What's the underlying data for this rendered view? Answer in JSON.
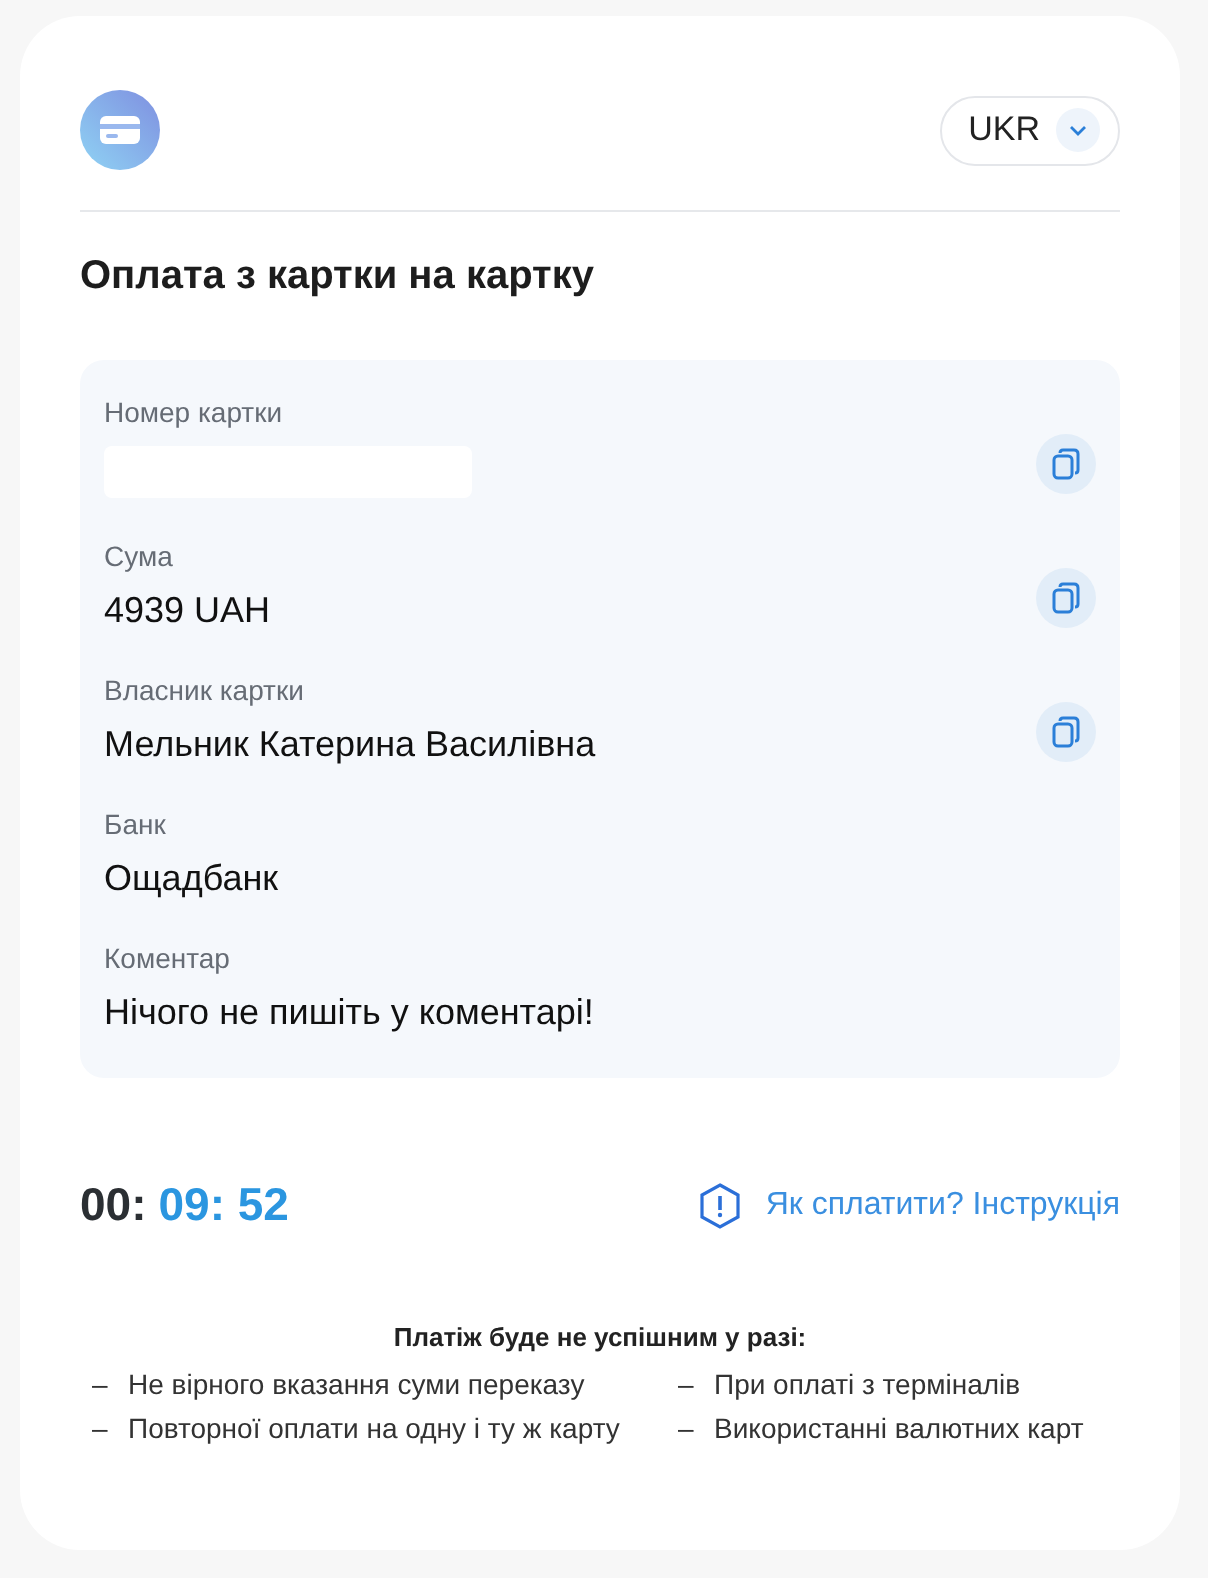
{
  "header": {
    "language": "UKR"
  },
  "title": "Оплата з картки на картку",
  "details": [
    {
      "label": "Номер картки",
      "kind": "redacted",
      "copyable": true
    },
    {
      "label": "Сума",
      "kind": "text",
      "value": "4939 UAH",
      "copyable": true
    },
    {
      "label": "Власник картки",
      "kind": "text",
      "value": "Мельник Катерина Василівна",
      "copyable": true
    },
    {
      "label": "Банк",
      "kind": "text",
      "value": "Ощадбанк",
      "copyable": false
    },
    {
      "label": "Коментар",
      "kind": "text",
      "value": "Нічого не пишіть у коментарі!",
      "copyable": false
    }
  ],
  "timer": [
    {
      "text": "00:",
      "highlighted": false
    },
    {
      "text": "09: 52",
      "highlighted": true
    }
  ],
  "help_link": "Як сплатити? Інструкція",
  "conditions": {
    "heading": "Платіж буде не успішним у разі:",
    "items": [
      {
        "marker": "–",
        "text": "Не вірного вказання суми переказу"
      },
      {
        "marker": "–",
        "text": "При оплаті з терміналів"
      },
      {
        "marker": "–",
        "text": "Повторної оплати на одну і ту ж карту"
      },
      {
        "marker": "–",
        "text": "Використанні валютних карт"
      }
    ]
  }
}
